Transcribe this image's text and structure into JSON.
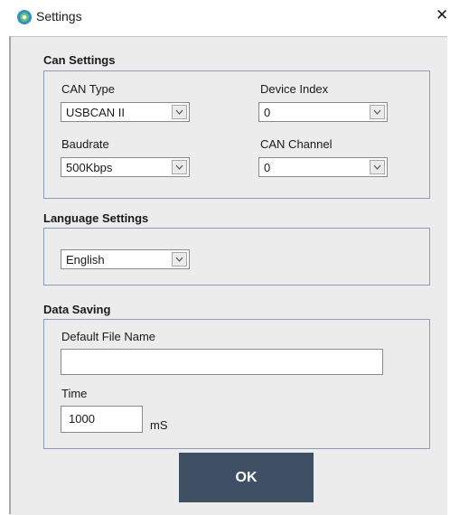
{
  "window": {
    "title": "Settings",
    "close_glyph": "✕"
  },
  "can_settings": {
    "title": "Can Settings",
    "can_type": {
      "label": "CAN Type",
      "value": "USBCAN II"
    },
    "device_index": {
      "label": "Device Index",
      "value": "0"
    },
    "baudrate": {
      "label": "Baudrate",
      "value": "500Kbps"
    },
    "can_channel": {
      "label": "CAN Channel",
      "value": "0"
    }
  },
  "language_settings": {
    "title": "Language Settings",
    "language": {
      "value": "English"
    }
  },
  "data_saving": {
    "title": "Data Saving",
    "file_name": {
      "label": "Default File Name",
      "value": ""
    },
    "time": {
      "label": "Time",
      "value": "1000",
      "unit": "mS"
    }
  },
  "ok_label": "OK",
  "colors": {
    "ok_button": "#3f5065",
    "dialog_background": "#ececec",
    "group_border": "#8f9bb3"
  },
  "icons": {
    "app": "settings-app-icon",
    "dropdown": "chevron-down-icon",
    "close": "close-icon"
  }
}
